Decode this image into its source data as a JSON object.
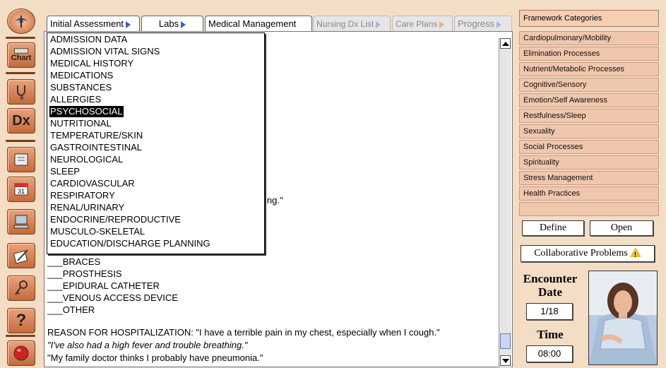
{
  "tabs": [
    {
      "label": "Initial Assessment"
    },
    {
      "label": "Labs"
    },
    {
      "label": "Medical Management"
    },
    {
      "label": "Nursing Dx List"
    },
    {
      "label": "Care Plans"
    },
    {
      "label": "Progress"
    }
  ],
  "toolbar": {
    "chart_label": "Chart",
    "dx_label": "Dx"
  },
  "menu": {
    "items": [
      "ADMISSION DATA",
      "ADMISSION VITAL SIGNS",
      "MEDICAL HISTORY",
      "MEDICATIONS",
      "SUBSTANCES",
      "ALLERGIES",
      "PSYCHOSOCIAL",
      "NUTRITIONAL",
      "TEMPERATURE/SKIN",
      "GASTROINTESTINAL",
      "NEUROLOGICAL",
      "SLEEP",
      "CARDIOVASCULAR",
      "RESPIRATORY",
      "RENAL/URINARY",
      "ENDOCRINE/REPRODUCTIVE",
      "MUSCULO-SKELETAL",
      "EDUCATION/DISCHARGE PLANNING"
    ],
    "selected": "PSYCHOSOCIAL"
  },
  "content": {
    "partial_text": "ing.\"",
    "device_items": [
      "___BRACES",
      "___PROSTHESIS",
      "___EPIDURAL CATHETER",
      "___VENOUS ACCESS DEVICE",
      "___OTHER"
    ],
    "reason_line": "REASON FOR HOSPITALIZATION: \"I have a terrible pain in my chest, especially when I cough.\"",
    "italic_line": "\"I've also had a high fever and trouble breathing.\"",
    "last_line": "\"My family doctor thinks I probably have pneumonia.\""
  },
  "framework": {
    "title": "Framework Categories",
    "items": [
      "Cardiopulmonary/Mobility",
      "Elimination Processes",
      "Nutrient/Metabolic Processes",
      "Cognitive/Sensory",
      "Emotion/Self Awareness",
      "Restfulness/Sleep",
      "Sexuality",
      "Social Processes",
      "Spirituality",
      "Stress Management",
      "Health Practices",
      ""
    ],
    "define_label": "Define",
    "open_label": "Open",
    "collab_label": "Collaborative Problems"
  },
  "encounter": {
    "date_label": "Encounter Date",
    "date_value": "1/18",
    "time_label": "Time",
    "time_value": "08:00"
  }
}
